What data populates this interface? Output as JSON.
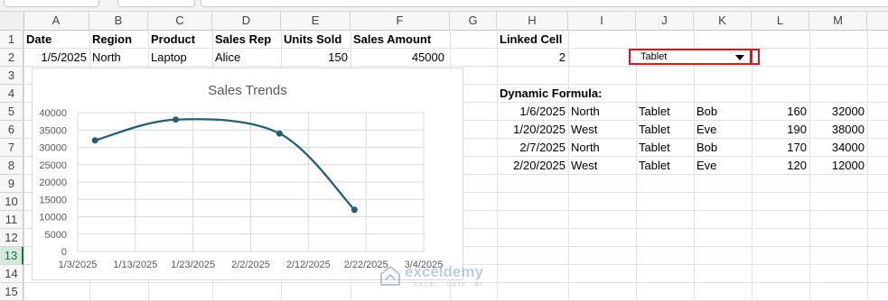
{
  "columns": [
    "A",
    "B",
    "C",
    "D",
    "E",
    "F",
    "G",
    "H",
    "I",
    "J",
    "K",
    "L",
    "M"
  ],
  "rows": [
    "1",
    "2",
    "3",
    "4",
    "5",
    "6",
    "7",
    "8",
    "9",
    "10",
    "11",
    "12",
    "13",
    "14",
    "15"
  ],
  "active_row": "13",
  "headers": {
    "date": "Date",
    "region": "Region",
    "product": "Product",
    "sales_rep": "Sales Rep",
    "units_sold": "Units Sold",
    "sales_amount": "Sales Amount",
    "linked_cell": "Linked Cell",
    "dynamic_formula": "Dynamic Formula:"
  },
  "row2": {
    "date": "1/5/2025",
    "region": "North",
    "product": "Laptop",
    "sales_rep": "Alice",
    "units_sold": "150",
    "sales_amount": "45000",
    "linked_value": "2",
    "dropdown_value": "Tablet"
  },
  "results": [
    {
      "date": "1/6/2025",
      "region": "North",
      "product": "Tablet",
      "rep": "Bob",
      "units": "160",
      "amount": "32000"
    },
    {
      "date": "1/20/2025",
      "region": "West",
      "product": "Tablet",
      "rep": "Eve",
      "units": "190",
      "amount": "38000"
    },
    {
      "date": "2/7/2025",
      "region": "North",
      "product": "Tablet",
      "rep": "Bob",
      "units": "170",
      "amount": "34000"
    },
    {
      "date": "2/20/2025",
      "region": "West",
      "product": "Tablet",
      "rep": "Eve",
      "units": "120",
      "amount": "12000"
    }
  ],
  "chart_data": {
    "type": "line",
    "title": "Sales Trends",
    "x": [
      "1/6/2025",
      "1/20/2025",
      "2/7/2025",
      "2/20/2025"
    ],
    "y": [
      32000,
      38000,
      34000,
      12000
    ],
    "ylim": [
      0,
      40000
    ],
    "yticks": [
      "0",
      "5000",
      "10000",
      "15000",
      "20000",
      "25000",
      "30000",
      "35000",
      "40000"
    ],
    "xticks": [
      "1/3/2025",
      "1/13/2025",
      "1/23/2025",
      "2/2/2025",
      "2/12/2025",
      "2/22/2025",
      "3/4/2025"
    ],
    "xlim": [
      "1/3/2025",
      "3/4/2025"
    ],
    "smooth": true,
    "grid": true,
    "line_color": "#1f5f7a"
  },
  "watermark": {
    "name": "exceldemy",
    "tagline": "EXCEL · DATA · BI"
  },
  "colors": {
    "dropdown_border": "#e0141e",
    "active_row": "#1f7246"
  }
}
